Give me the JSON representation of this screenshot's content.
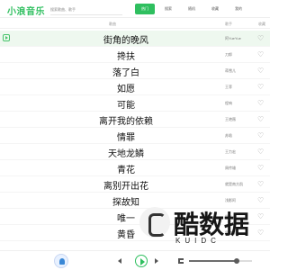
{
  "header": {
    "logo": "小浪音乐",
    "search_placeholder": "搜索歌曲、歌手",
    "tabs": [
      "热门",
      "搜索",
      "随机",
      "收藏",
      "我的"
    ]
  },
  "table": {
    "col_title": "歌曲",
    "col_singer": "歌手",
    "col_fav": "收藏",
    "rows": [
      {
        "song": "街角的晚风",
        "singer": "阿YueYue",
        "active": true
      },
      {
        "song": "搀扶",
        "singer": "刀郎"
      },
      {
        "song": "落了白",
        "singer": "蒋雪儿"
      },
      {
        "song": "如愿",
        "singer": "王菲"
      },
      {
        "song": "可能",
        "singer": "程响"
      },
      {
        "song": "离开我的依赖",
        "singer": "王艳薇"
      },
      {
        "song": "情罪",
        "singer": "苏晗"
      },
      {
        "song": "天地龙鳞",
        "singer": "王力宏"
      },
      {
        "song": "青花",
        "singer": "周传雄"
      },
      {
        "song": "离别开出花",
        "singer": "就是南方凯"
      },
      {
        "song": "探故知",
        "singer": "浅影阿"
      },
      {
        "song": "唯一",
        "singer": "告五人"
      },
      {
        "song": "黄昏",
        "singer": "周传雄"
      }
    ]
  },
  "player": {
    "volume_fraction": 0.76
  },
  "watermark": {
    "text": "酷数据",
    "sub": "KUIDC"
  }
}
